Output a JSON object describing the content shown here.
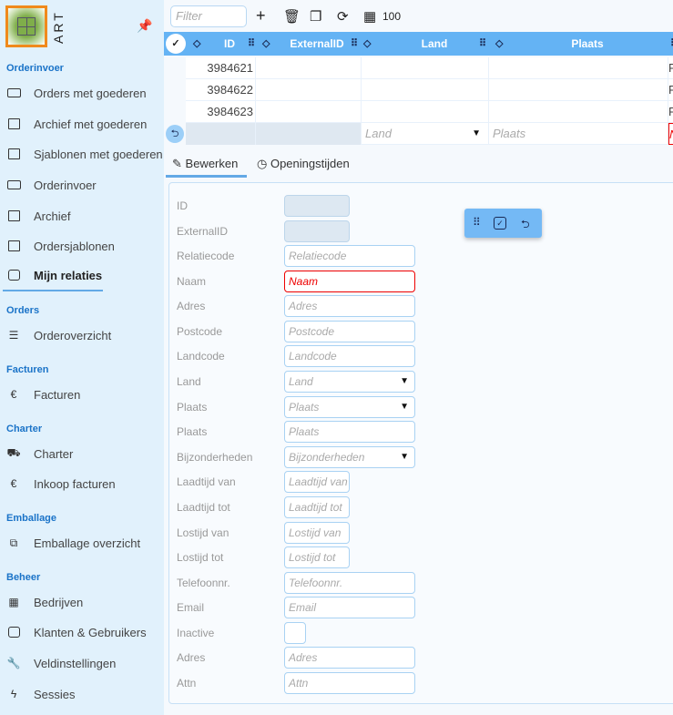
{
  "sidebar": {
    "logo_text": "ART",
    "sections": [
      "Orderinvoer",
      "Orders",
      "Facturen",
      "Charter",
      "Emballage",
      "Beheer"
    ],
    "items": [
      {
        "label": "Orders met goederen",
        "icon": "keyboard-icon"
      },
      {
        "label": "Archief met goederen",
        "icon": "archive-icon"
      },
      {
        "label": "Sjablonen met goederen",
        "icon": "template-icon"
      },
      {
        "label": "Orderinvoer",
        "icon": "keyboard-icon"
      },
      {
        "label": "Archief",
        "icon": "archive-icon"
      },
      {
        "label": "Ordersjablonen",
        "icon": "template-icon"
      },
      {
        "label": "Mijn relaties",
        "icon": "contacts-icon",
        "active": true
      },
      {
        "label": "Orderoverzicht",
        "icon": "list-icon"
      },
      {
        "label": "Facturen",
        "icon": "invoice-icon"
      },
      {
        "label": "Charter",
        "icon": "truck-icon"
      },
      {
        "label": "Inkoop facturen",
        "icon": "invoice-icon"
      },
      {
        "label": "Emballage overzicht",
        "icon": "boxes-icon"
      },
      {
        "label": "Bedrijven",
        "icon": "building-icon"
      },
      {
        "label": "Klanten & Gebruikers",
        "icon": "user-card-icon"
      },
      {
        "label": "Veldinstellingen",
        "icon": "wrench-icon"
      },
      {
        "label": "Sessies",
        "icon": "bolt-icon"
      }
    ]
  },
  "toolbar": {
    "filter_placeholder": "Filter",
    "page_size": "100"
  },
  "grid": {
    "columns": [
      "ID",
      "ExternalID",
      "Land",
      "Plaats"
    ],
    "rows": [
      {
        "id": "3984621",
        "next": "F"
      },
      {
        "id": "3984622",
        "next": "F"
      },
      {
        "id": "3984623",
        "next": "F"
      }
    ],
    "new_row": {
      "land_placeholder": "Land",
      "plaats_placeholder": "Plaats",
      "next": "N"
    }
  },
  "tabs": [
    {
      "label": "Bewerken",
      "active": true
    },
    {
      "label": "Openingstijden"
    }
  ],
  "form": {
    "fields": [
      {
        "label": "ID",
        "placeholder": ""
      },
      {
        "label": "ExternalID",
        "placeholder": ""
      },
      {
        "label": "Relatiecode",
        "placeholder": "Relatiecode"
      },
      {
        "label": "Naam",
        "placeholder": "Naam"
      },
      {
        "label": "Adres",
        "placeholder": "Adres"
      },
      {
        "label": "Postcode",
        "placeholder": "Postcode"
      },
      {
        "label": "Landcode",
        "placeholder": "Landcode"
      },
      {
        "label": "Land",
        "placeholder": "Land"
      },
      {
        "label": "Plaats",
        "placeholder": "Plaats"
      },
      {
        "label": "Plaats",
        "placeholder": "Plaats"
      },
      {
        "label": "Bijzonderheden",
        "placeholder": "Bijzonderheden"
      },
      {
        "label": "Laadtijd van",
        "placeholder": "Laadtijd van"
      },
      {
        "label": "Laadtijd tot",
        "placeholder": "Laadtijd tot"
      },
      {
        "label": "Lostijd van",
        "placeholder": "Lostijd van"
      },
      {
        "label": "Lostijd tot",
        "placeholder": "Lostijd tot"
      },
      {
        "label": "Telefoonnr.",
        "placeholder": "Telefoonnr."
      },
      {
        "label": "Email",
        "placeholder": "Email"
      },
      {
        "label": "Inactive",
        "placeholder": ""
      },
      {
        "label": "Adres",
        "placeholder": "Adres"
      },
      {
        "label": "Attn",
        "placeholder": "Attn"
      }
    ]
  },
  "colors": {
    "accent": "#64b3f4",
    "sidebar_bg": "#e1f1fc",
    "error": "#e00000",
    "logo_border": "#f08a1c"
  }
}
